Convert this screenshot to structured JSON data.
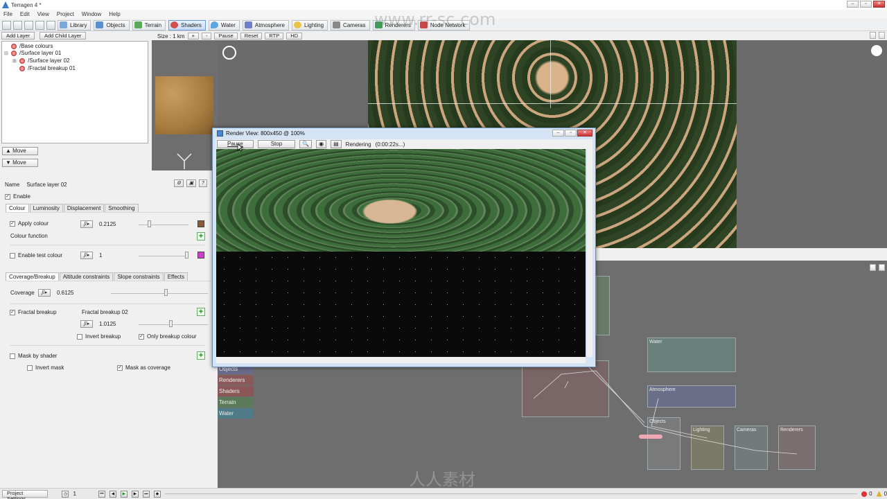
{
  "window": {
    "title": "Terragen 4 *"
  },
  "menu": [
    "File",
    "Edit",
    "View",
    "Project",
    "Window",
    "Help"
  ],
  "toolbar": {
    "buttons": [
      {
        "label": "Library",
        "color": "#7ba7d8"
      },
      {
        "label": "Objects",
        "color": "#5a8fd0"
      },
      {
        "label": "Terrain",
        "color": "#5aa85a"
      },
      {
        "label": "Shaders",
        "color": "#d05050"
      },
      {
        "label": "Water",
        "color": "#59a6e0"
      },
      {
        "label": "Atmosphere",
        "color": "#6d7fc8"
      },
      {
        "label": "Lighting",
        "color": "#e8c548"
      },
      {
        "label": "Cameras",
        "color": "#888888"
      },
      {
        "label": "Renderers",
        "color": "#3aa05a"
      },
      {
        "label": "Node Network",
        "color": "#c84848"
      }
    ]
  },
  "layers": {
    "add_layer": "Add Layer",
    "add_child_layer": "Add Child Layer",
    "items": [
      "/Base colours",
      "/Surface layer 01",
      "/Surface layer 02",
      "/Fractal breakup 01"
    ],
    "move_up": "Move",
    "move_down": "Move"
  },
  "preview": {
    "size_label": "Size : 1 km",
    "plus": "+",
    "minus": "-",
    "pause": "Pause",
    "reset": "Reset",
    "rtp": "RTP",
    "hd": "HD"
  },
  "settings": {
    "name_label": "Name",
    "name_value": "Surface layer 02",
    "enable_label": "Enable",
    "tabs1": [
      "Colour",
      "Luminosity",
      "Displacement",
      "Smoothing"
    ],
    "apply_colour_label": "Apply colour",
    "apply_colour_value": "0.2125",
    "apply_colour_swatch": "#8a5a3a",
    "colour_function_label": "Colour function",
    "test_colour_label": "Enable test colour",
    "test_colour_value": "1",
    "test_colour_swatch": "#d040d0",
    "tabs2": [
      "Coverage/Breakup",
      "Altitude constraints",
      "Slope constraints",
      "Effects"
    ],
    "coverage_label": "Coverage",
    "coverage_value": "0.6125",
    "fractal_label": "Fractal breakup",
    "fractal_node": "Fractal breakup 02",
    "fractal_value": "1.0125",
    "invert_breakup": "Invert breakup",
    "only_breakup": "Only breakup colour",
    "mask_by_shader": "Mask by shader",
    "invert_mask": "Invert mask",
    "mask_as_coverage": "Mask as coverage"
  },
  "render_view": {
    "title": "Render View: 800x450 @ 100%",
    "pause": "Pause",
    "stop": "Stop",
    "status": "Rendering",
    "elapsed": "(0:00:22s...)",
    "progress": 0.5
  },
  "node_network": {
    "categories": [
      {
        "label": "Objects",
        "color": "#6a6a8a"
      },
      {
        "label": "Renderers",
        "color": "#8a5a5a"
      },
      {
        "label": "Shaders",
        "color": "#8a5656"
      },
      {
        "label": "Terrain",
        "color": "#5a7a5a"
      },
      {
        "label": "Water",
        "color": "#4f7a88"
      }
    ],
    "groups": [
      "Water",
      "Atmosphere",
      "Objects",
      "Lighting",
      "Cameras",
      "Renderers"
    ]
  },
  "status": {
    "project_settings": "Project Settings",
    "frame": "1",
    "errors": "0",
    "warnings": "0"
  },
  "watermarks": {
    "top": "www.rr-sc.com",
    "bottom": "人人素材"
  }
}
